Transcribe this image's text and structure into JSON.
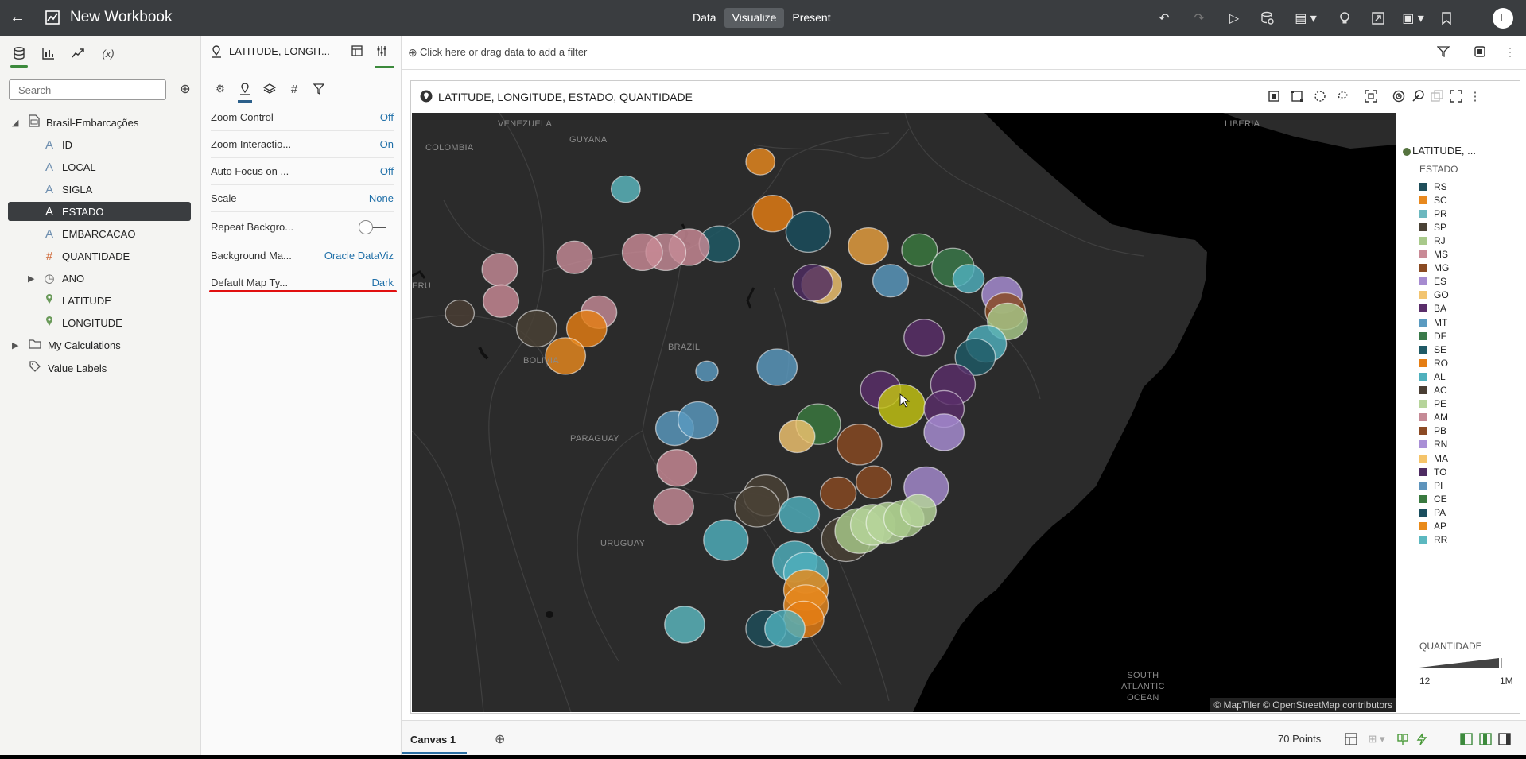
{
  "app": {
    "title": "New Workbook",
    "user_initial": "L"
  },
  "modes": [
    "Data",
    "Visualize",
    "Present"
  ],
  "active_mode": "Visualize",
  "data_panel": {
    "search_placeholder": "Search",
    "dataset": "Brasil-Embarcações",
    "fields": [
      {
        "name": "ID",
        "type": "attribute"
      },
      {
        "name": "LOCAL",
        "type": "attribute"
      },
      {
        "name": "SIGLA",
        "type": "attribute"
      },
      {
        "name": "ESTADO",
        "type": "attribute",
        "selected": true
      },
      {
        "name": "EMBARCACAO",
        "type": "attribute"
      },
      {
        "name": "QUANTIDADE",
        "type": "measure"
      },
      {
        "name": "ANO",
        "type": "time"
      },
      {
        "name": "LATITUDE",
        "type": "location"
      },
      {
        "name": "LONGITUDE",
        "type": "location"
      }
    ],
    "my_calculations": "My Calculations",
    "value_labels": "Value Labels"
  },
  "properties_panel": {
    "header": "LATITUDE, LONGIT...",
    "rows": [
      {
        "label": "Zoom Control",
        "value": "Off"
      },
      {
        "label": "Zoom Interactio...",
        "value": "On"
      },
      {
        "label": "Auto Focus on ...",
        "value": "Off"
      },
      {
        "label": "Scale",
        "value": "None"
      },
      {
        "label": "Repeat Backgro...",
        "value": ""
      },
      {
        "label": "Background Ma...",
        "value": "Oracle DataViz"
      },
      {
        "label": "Default Map Ty...",
        "value": "Dark"
      }
    ]
  },
  "filter_bar": {
    "placeholder": "Click here or drag data to add a filter"
  },
  "visualization": {
    "title": "LATITUDE, LONGITUDE, ESTADO, QUANTIDADE",
    "map_labels": {
      "venezuela": "VENEZUELA",
      "guyana": "GUYANA",
      "colombia": "COLOMBIA",
      "liberia": "LIBERIA",
      "peru": "ERU",
      "bolivia": "BOLIVIA",
      "brazil": "BRAZIL",
      "paraguay": "PARAGUAY",
      "uruguay": "URUGUAY",
      "ocean1": "SOUTH",
      "ocean2": "ATLANTIC",
      "ocean3": "OCEAN"
    },
    "attribution": "© MapTiler © OpenStreetMap contributors",
    "legend": {
      "layer": "LATITUDE, ...",
      "color_title": "ESTADO",
      "items": [
        {
          "label": "RS",
          "color": "#1f4e5a"
        },
        {
          "label": "SC",
          "color": "#e8891e"
        },
        {
          "label": "PR",
          "color": "#6cb8bf"
        },
        {
          "label": "SP",
          "color": "#4a4236"
        },
        {
          "label": "RJ",
          "color": "#a8c98a"
        },
        {
          "label": "MS",
          "color": "#c98a96"
        },
        {
          "label": "MG",
          "color": "#8a4a22"
        },
        {
          "label": "ES",
          "color": "#a68bd0"
        },
        {
          "label": "GO",
          "color": "#f2c470"
        },
        {
          "label": "BA",
          "color": "#5a2e6a"
        },
        {
          "label": "MT",
          "color": "#5a9ac0"
        },
        {
          "label": "DF",
          "color": "#3a7a4a"
        },
        {
          "label": "SE",
          "color": "#1f5a66"
        },
        {
          "label": "RO",
          "color": "#e57e14"
        },
        {
          "label": "AL",
          "color": "#4fb0bd"
        },
        {
          "label": "AC",
          "color": "#4a3e34"
        },
        {
          "label": "PE",
          "color": "#b6d49a"
        },
        {
          "label": "AM",
          "color": "#c58a96"
        },
        {
          "label": "PB",
          "color": "#8c4a24"
        },
        {
          "label": "RN",
          "color": "#a98fd6"
        },
        {
          "label": "MA",
          "color": "#f5c46a"
        },
        {
          "label": "TO",
          "color": "#4e2c62"
        },
        {
          "label": "PI",
          "color": "#5e94bc"
        },
        {
          "label": "CE",
          "color": "#3a7a40"
        },
        {
          "label": "PA",
          "color": "#1a4e5e"
        },
        {
          "label": "AP",
          "color": "#e98a1a"
        },
        {
          "label": "RR",
          "color": "#5cb8c0"
        }
      ],
      "size_title": "QUANTIDADE",
      "size_min": "12",
      "size_max": "1M"
    }
  },
  "canvas": {
    "tab": "Canvas 1",
    "points": "70 Points"
  }
}
